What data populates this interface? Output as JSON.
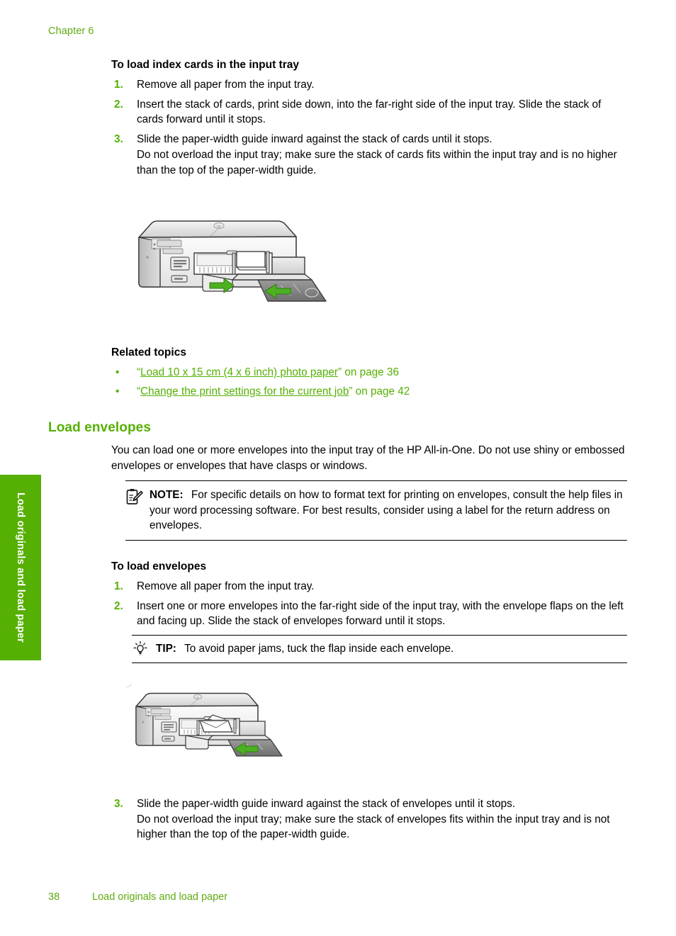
{
  "colors": {
    "green": "#55b003",
    "footer_green": "#5faa10",
    "tab_green": "#55b003",
    "text": "#000000"
  },
  "header": {
    "chapter_label": "Chapter 6"
  },
  "side_tab": {
    "label": "Load originals and load paper"
  },
  "index_cards_section": {
    "heading": "To load index cards in the input tray",
    "steps": [
      {
        "num": "1.",
        "text": "Remove all paper from the input tray.",
        "sub": ""
      },
      {
        "num": "2.",
        "text": "Insert the stack of cards, print side down, into the far-right side of the input tray. Slide the stack of cards forward until it stops.",
        "sub": ""
      },
      {
        "num": "3.",
        "text": "Slide the paper-width guide inward against the stack of cards until it stops.",
        "sub": "Do not overload the input tray; make sure the stack of cards fits within the input tray and is no higher than the top of the paper-width guide."
      }
    ]
  },
  "illustration_1": {
    "alt": "HP All-in-One printer with index cards loaded in the input tray and green arrows showing the paper-width guide sliding inward"
  },
  "related_topics": {
    "heading": "Related topics",
    "items": [
      {
        "bullet": "•",
        "quote_open": "“",
        "link": "Load 10 x 15 cm (4 x 6 inch) photo paper",
        "quote_close": "”",
        "tail": " on page 36"
      },
      {
        "bullet": "•",
        "quote_open": "“",
        "link": "Change the print settings for the current job",
        "quote_close": "”",
        "tail": " on page 42"
      }
    ]
  },
  "load_envelopes_section": {
    "heading": "Load envelopes",
    "intro": "You can load one or more envelopes into the input tray of the HP All-in-One. Do not use shiny or embossed envelopes or envelopes that have clasps or windows.",
    "note": {
      "icon": "note-clipboard-icon",
      "label": "NOTE:",
      "text": "For specific details on how to format text for printing on envelopes, consult the help files in your word processing software. For best results, consider using a label for the return address on envelopes."
    },
    "procedure_heading": "To load envelopes",
    "steps": [
      {
        "num": "1.",
        "text": "Remove all paper from the input tray."
      },
      {
        "num": "2.",
        "text": "Insert one or more envelopes into the far-right side of the input tray, with the envelope flaps on the left and facing up. Slide the stack of envelopes forward until it stops."
      }
    ],
    "tip": {
      "icon": "tip-lightbulb-icon",
      "label": "TIP:",
      "text": "To avoid paper jams, tuck the flap inside each envelope."
    },
    "final_step": {
      "num": "3.",
      "text": "Slide the paper-width guide inward against the stack of envelopes until it stops.",
      "sub": "Do not overload the input tray; make sure the stack of envelopes fits within the input tray and is not higher than the top of the paper-width guide."
    }
  },
  "illustration_2": {
    "alt": "HP All-in-One printer with an envelope loaded in the input tray and a green arrow showing the direction of insertion"
  },
  "footer": {
    "page_number": "38",
    "title": "Load originals and load paper"
  }
}
